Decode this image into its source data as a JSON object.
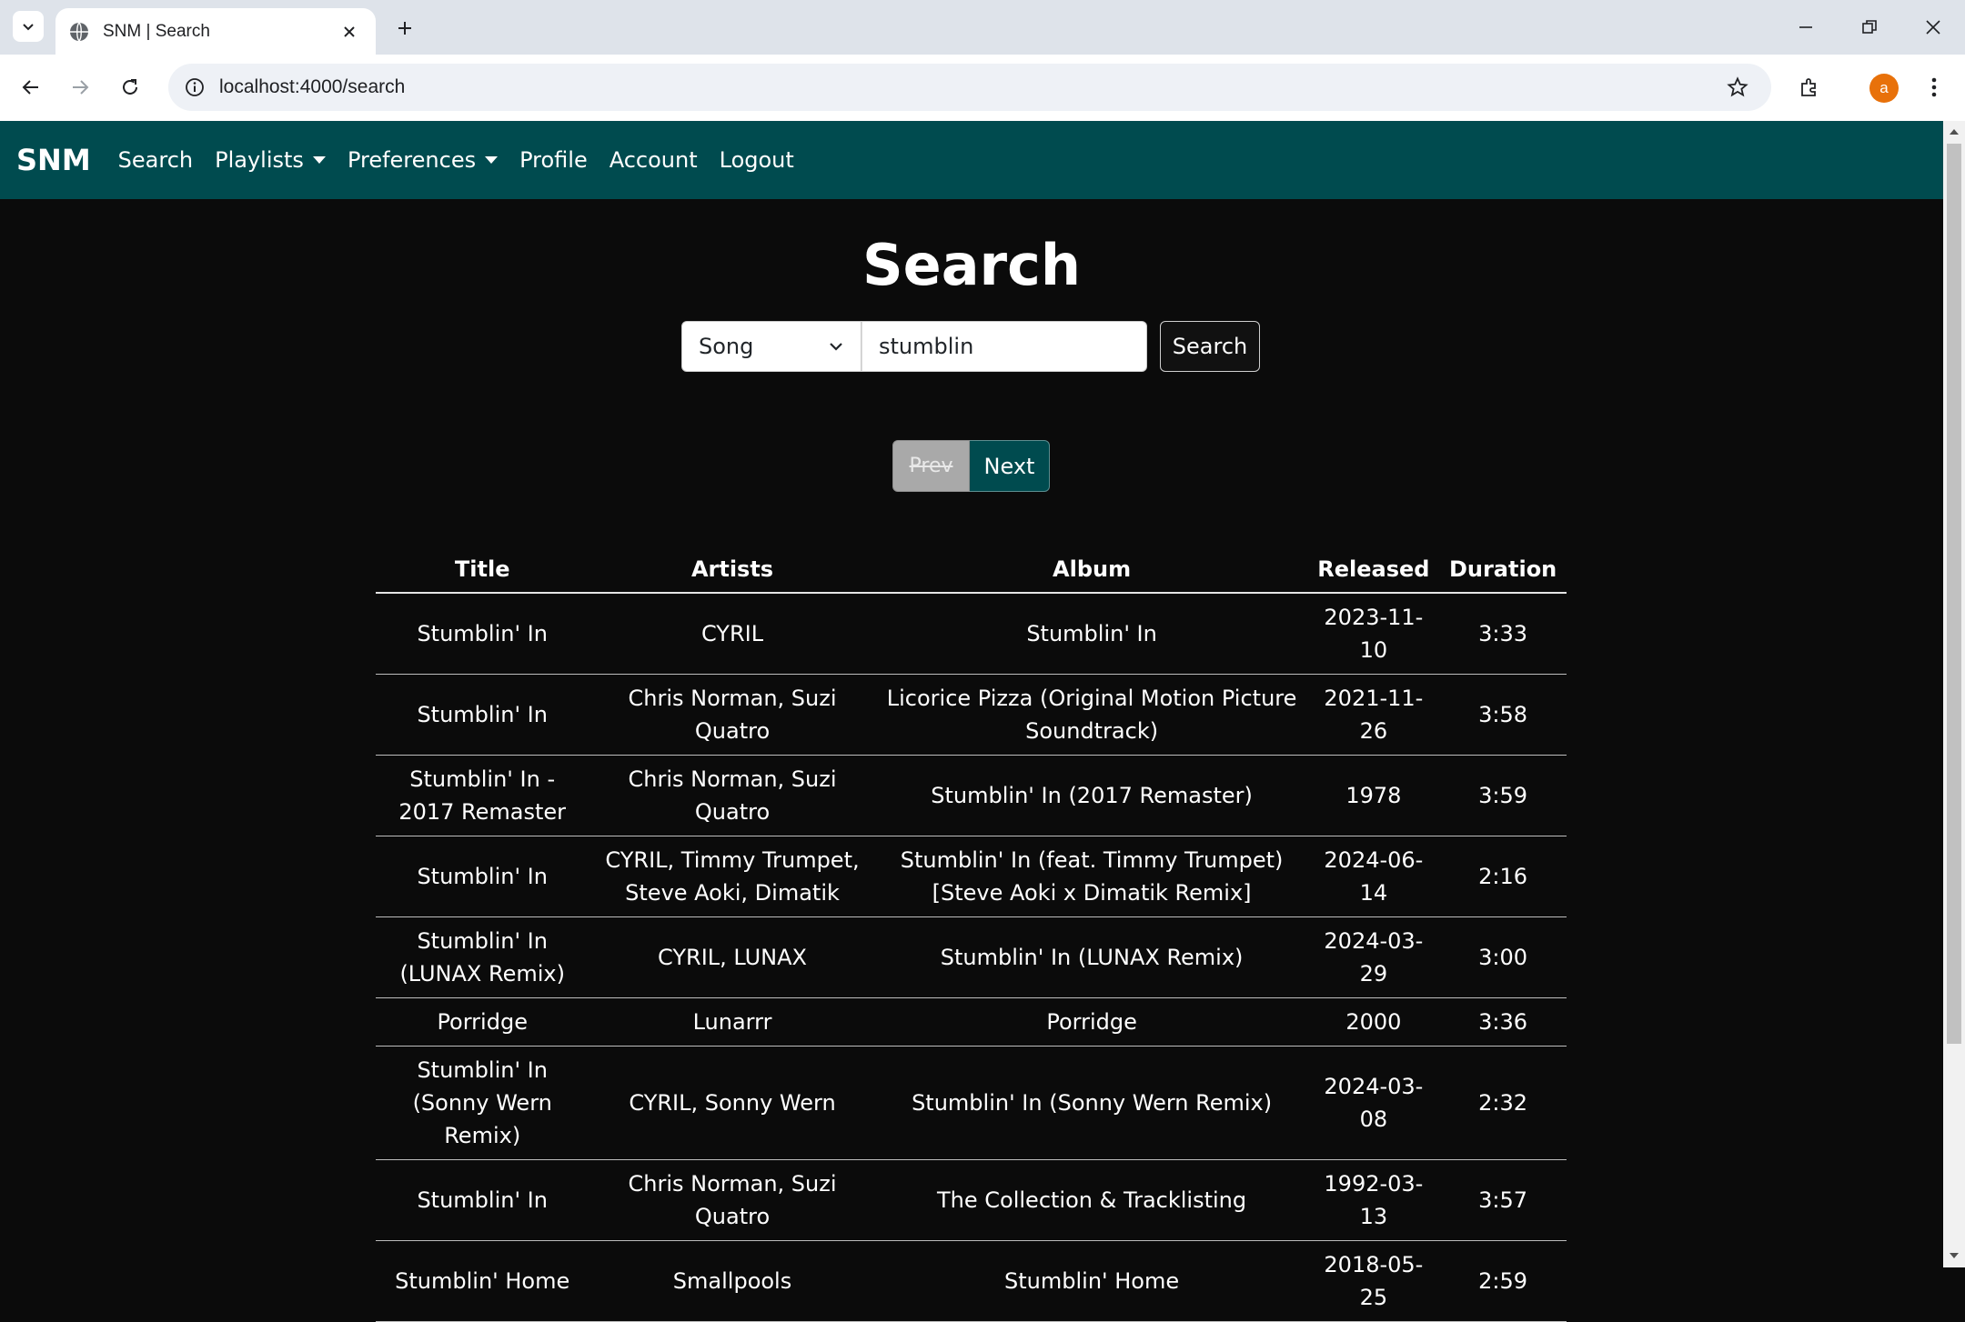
{
  "browser": {
    "tab_title": "SNM | Search",
    "url": "localhost:4000/search",
    "profile_initial": "a"
  },
  "nav": {
    "brand": "SNM",
    "links": [
      "Search",
      "Playlists",
      "Preferences",
      "Profile",
      "Account",
      "Logout"
    ]
  },
  "page": {
    "title": "Search",
    "search_type": "Song",
    "search_value": "stumblin",
    "search_button": "Search",
    "prev_label": "Prev",
    "next_label": "Next"
  },
  "table": {
    "headers": [
      "Title",
      "Artists",
      "Album",
      "Released",
      "Duration"
    ],
    "rows": [
      [
        "Stumblin' In",
        "CYRIL",
        "Stumblin' In",
        "2023-11-10",
        "3:33"
      ],
      [
        "Stumblin' In",
        "Chris Norman, Suzi Quatro",
        "Licorice Pizza (Original Motion Picture Soundtrack)",
        "2021-11-26",
        "3:58"
      ],
      [
        "Stumblin' In - 2017 Remaster",
        "Chris Norman, Suzi Quatro",
        "Stumblin' In (2017 Remaster)",
        "1978",
        "3:59"
      ],
      [
        "Stumblin' In",
        "CYRIL, Timmy Trumpet, Steve Aoki, Dimatik",
        "Stumblin' In (feat. Timmy Trumpet) [Steve Aoki x Dimatik Remix]",
        "2024-06-14",
        "2:16"
      ],
      [
        "Stumblin' In (LUNAX Remix)",
        "CYRIL, LUNAX",
        "Stumblin' In (LUNAX Remix)",
        "2024-03-29",
        "3:00"
      ],
      [
        "Porridge",
        "Lunarrr",
        "Porridge",
        "2000",
        "3:36"
      ],
      [
        "Stumblin' In (Sonny Wern Remix)",
        "CYRIL, Sonny Wern",
        "Stumblin' In (Sonny Wern Remix)",
        "2024-03-08",
        "2:32"
      ],
      [
        "Stumblin' In",
        "Chris Norman, Suzi Quatro",
        "The Collection & Tracklisting",
        "1992-03-13",
        "3:57"
      ],
      [
        "Stumblin' Home",
        "Smallpools",
        "Stumblin' Home",
        "2018-05-25",
        "2:59"
      ]
    ]
  }
}
